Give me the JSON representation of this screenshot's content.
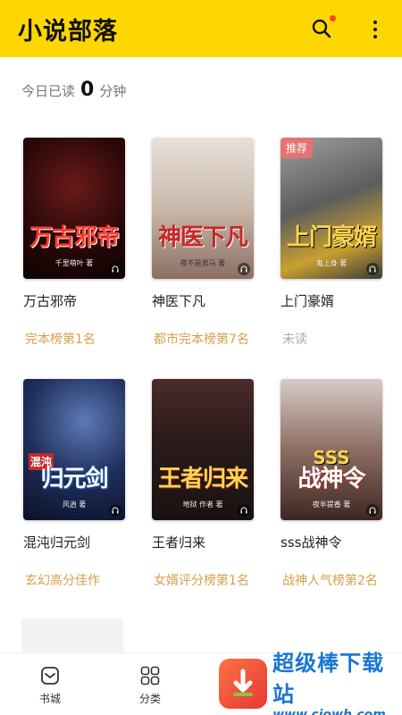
{
  "header": {
    "title": "小说部落"
  },
  "reading": {
    "prefix": "今日已读",
    "minutes": "0",
    "unit": "分钟"
  },
  "books": [
    {
      "name": "万古邪帝",
      "cover_title": "万古邪帝",
      "author": "千里萌叶 著",
      "tag": "完本榜第1名",
      "badge": ""
    },
    {
      "name": "神医下凡",
      "cover_title": "神医下凡",
      "author": "夜不是男马 著",
      "tag": "都市完本榜第7名",
      "badge": ""
    },
    {
      "name": "上门豪婿",
      "cover_title": "上门豪婿",
      "author": "鬼上身 著",
      "tag": "未读",
      "badge": "推荐"
    },
    {
      "name": "混沌归元剑",
      "cover_title": "归元剑",
      "cover_prefix": "混沌",
      "author": "风逍 著",
      "tag": "玄幻高分佳作",
      "badge": ""
    },
    {
      "name": "王者归来",
      "cover_title": "王者归来",
      "author": "地狱 作者 著",
      "tag": "女婿评分榜第1名",
      "badge": ""
    },
    {
      "name": "sss战神令",
      "cover_title": "战神令",
      "cover_prefix": "SSS",
      "author": "夜半提香 著",
      "tag": "战神人气榜第2名",
      "badge": ""
    }
  ],
  "nav": [
    {
      "label": "书城",
      "icon": "bookstore-icon"
    },
    {
      "label": "分类",
      "icon": "category-icon"
    }
  ],
  "watermark": {
    "main": "超级棒下载站",
    "sub": "www.cjowh.com"
  },
  "colors": {
    "accent": "#ffd700",
    "tag": "#d6a04a",
    "badge": "#e57373"
  }
}
